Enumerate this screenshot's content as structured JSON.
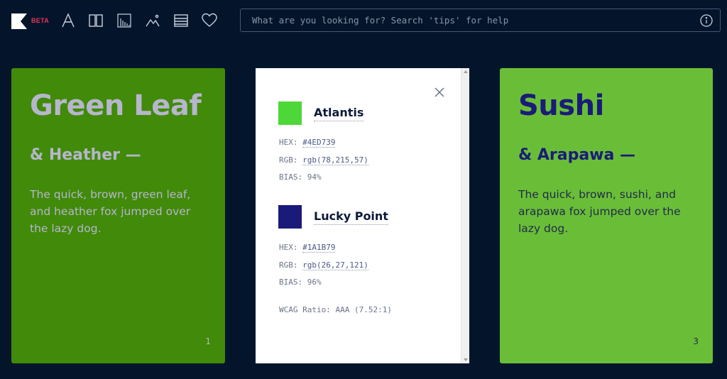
{
  "header": {
    "beta": "BETA",
    "search_placeholder": "What are you looking for? Search 'tips' for help"
  },
  "toolbar": {
    "icons": [
      "typography-icon",
      "columns-icon",
      "chart-icon",
      "image-icon",
      "list-icon",
      "heart-icon"
    ]
  },
  "left_card": {
    "title": "Green Leaf",
    "subtitle": "& Heather —",
    "body": "The quick, brown, green leaf, and heather fox jumped over the lazy dog.",
    "number": "1",
    "background": "#418A0A",
    "text_color": "#B6B6CC"
  },
  "panel": {
    "color1": {
      "name": "Atlantis",
      "swatch": "#4ED739",
      "hex_label": "HEX:",
      "hex": "#4ED739",
      "rgb_label": "RGB:",
      "rgb": "rgb(78,215,57)",
      "bias": "BIAS: 94%"
    },
    "color2": {
      "name": "Lucky Point",
      "swatch": "#1A1B79",
      "hex_label": "HEX:",
      "hex": "#1A1B79",
      "rgb_label": "RGB:",
      "rgb": "rgb(26,27,121)",
      "bias": "BIAS: 96%"
    },
    "wcag": "WCAG Ratio: AAA (7.52:1)"
  },
  "right_card": {
    "title": "Sushi",
    "subtitle": "& Arapawa —",
    "body": "The quick, brown, sushi, and arapawa fox jumped over the lazy dog.",
    "number": "3",
    "background": "#6ABE37",
    "text_color": "#1A1B79"
  }
}
